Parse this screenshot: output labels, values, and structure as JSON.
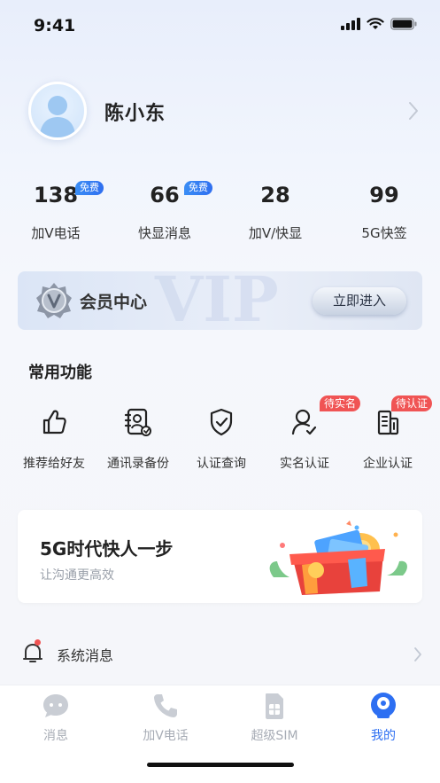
{
  "status_bar": {
    "time": "9:41"
  },
  "profile": {
    "name": "陈小东"
  },
  "stats": [
    {
      "value": "138",
      "label": "加V电话",
      "badge": "免费"
    },
    {
      "value": "66",
      "label": "快显消息",
      "badge": "免费"
    },
    {
      "value": "28",
      "label": "加V/快显",
      "badge": ""
    },
    {
      "value": "99",
      "label": "5G快签",
      "badge": ""
    }
  ],
  "vip": {
    "watermark": "VIP",
    "title": "会员中心",
    "button": "立即进入"
  },
  "common_functions": {
    "title": "常用功能",
    "items": [
      {
        "label": "推荐给好友",
        "icon": "thumbs-up-icon",
        "badge": ""
      },
      {
        "label": "通讯录备份",
        "icon": "contact-backup-icon",
        "badge": ""
      },
      {
        "label": "认证查询",
        "icon": "shield-check-icon",
        "badge": ""
      },
      {
        "label": "实名认证",
        "icon": "user-check-icon",
        "badge": "待实名"
      },
      {
        "label": "企业认证",
        "icon": "building-icon",
        "badge": "待认证"
      }
    ]
  },
  "promo": {
    "title": "5G时代快人一步",
    "subtitle": "让沟通更高效"
  },
  "system_message": {
    "label": "系统消息",
    "has_unread": true
  },
  "tab_bar": {
    "tabs": [
      {
        "label": "消息",
        "icon": "message-icon",
        "active": false
      },
      {
        "label": "加V电话",
        "icon": "phone-icon",
        "active": false
      },
      {
        "label": "超级SIM",
        "icon": "sim-card-icon",
        "active": false
      },
      {
        "label": "我的",
        "icon": "profile-icon",
        "active": true
      }
    ]
  },
  "colors": {
    "accent": "#2d6ff2",
    "badge_blue": "#3a8df5",
    "badge_red": "#f05454",
    "inactive": "#a7acb5"
  }
}
